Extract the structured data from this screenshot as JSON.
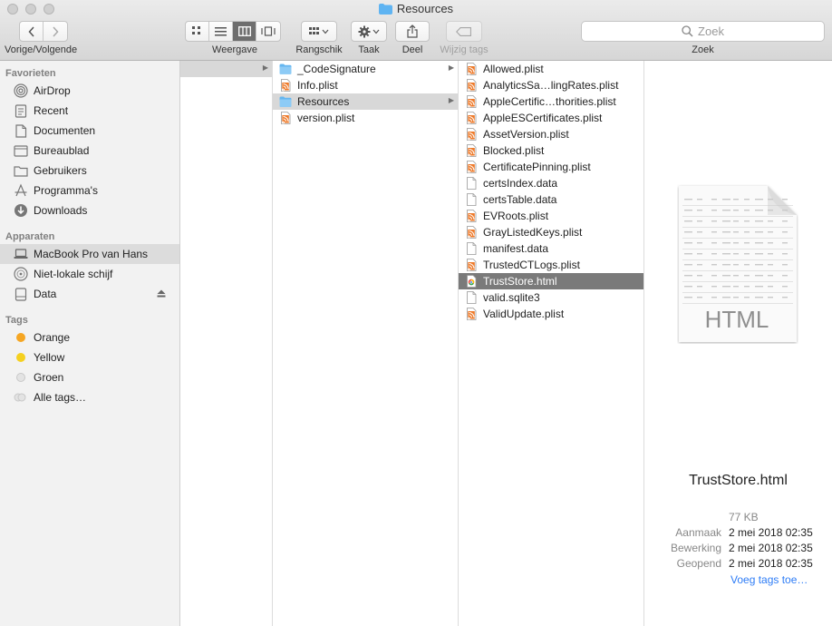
{
  "window": {
    "title": "Resources"
  },
  "toolbar": {
    "nav_label": "Vorige/Volgende",
    "view_label": "Weergave",
    "arrange_label": "Rangschik",
    "action_label": "Taak",
    "share_label": "Deel",
    "edit_tags_label": "Wijzig tags",
    "search_placeholder": "Zoek",
    "search_label": "Zoek"
  },
  "sidebar": {
    "favorites_header": "Favorieten",
    "favorites": [
      "AirDrop",
      "Recent",
      "Documenten",
      "Bureaublad",
      "Gebruikers",
      "Programma's",
      "Downloads"
    ],
    "devices_header": "Apparaten",
    "devices": [
      "MacBook Pro van Hans",
      "Niet-lokale schijf",
      "Data"
    ],
    "tags_header": "Tags",
    "tags": [
      {
        "label": "Orange",
        "color": "#f5a623"
      },
      {
        "label": "Yellow",
        "color": "#f5d020"
      },
      {
        "label": "Groen",
        "color": "#d9d9d9"
      },
      {
        "label": "Alle tags…",
        "color": "#d9d9d9"
      }
    ]
  },
  "column2": {
    "items": [
      {
        "name": "_CodeSignature",
        "type": "folder"
      },
      {
        "name": "Info.plist",
        "type": "plist"
      },
      {
        "name": "Resources",
        "type": "folder"
      },
      {
        "name": "version.plist",
        "type": "plist"
      }
    ]
  },
  "column3": {
    "items": [
      {
        "name": "Allowed.plist",
        "type": "plist"
      },
      {
        "name": "AnalyticsSa…lingRates.plist",
        "type": "plist"
      },
      {
        "name": "AppleCertific…thorities.plist",
        "type": "plist"
      },
      {
        "name": "AppleESCertificates.plist",
        "type": "plist"
      },
      {
        "name": "AssetVersion.plist",
        "type": "plist"
      },
      {
        "name": "Blocked.plist",
        "type": "plist"
      },
      {
        "name": "CertificatePinning.plist",
        "type": "plist"
      },
      {
        "name": "certsIndex.data",
        "type": "data"
      },
      {
        "name": "certsTable.data",
        "type": "data"
      },
      {
        "name": "EVRoots.plist",
        "type": "plist"
      },
      {
        "name": "GrayListedKeys.plist",
        "type": "plist"
      },
      {
        "name": "manifest.data",
        "type": "data"
      },
      {
        "name": "TrustedCTLogs.plist",
        "type": "plist"
      },
      {
        "name": "TrustStore.html",
        "type": "html"
      },
      {
        "name": "valid.sqlite3",
        "type": "data"
      },
      {
        "name": "ValidUpdate.plist",
        "type": "plist"
      }
    ]
  },
  "preview": {
    "doc_label": "HTML",
    "name": "TrustStore.html",
    "size": "77 KB",
    "created_label": "Aanmaak",
    "created": "2 mei 2018 02:35",
    "modified_label": "Bewerking",
    "modified": "2 mei 2018 02:35",
    "opened_label": "Geopend",
    "opened": "2 mei 2018 02:35",
    "add_tags": "Voeg tags toe…"
  }
}
